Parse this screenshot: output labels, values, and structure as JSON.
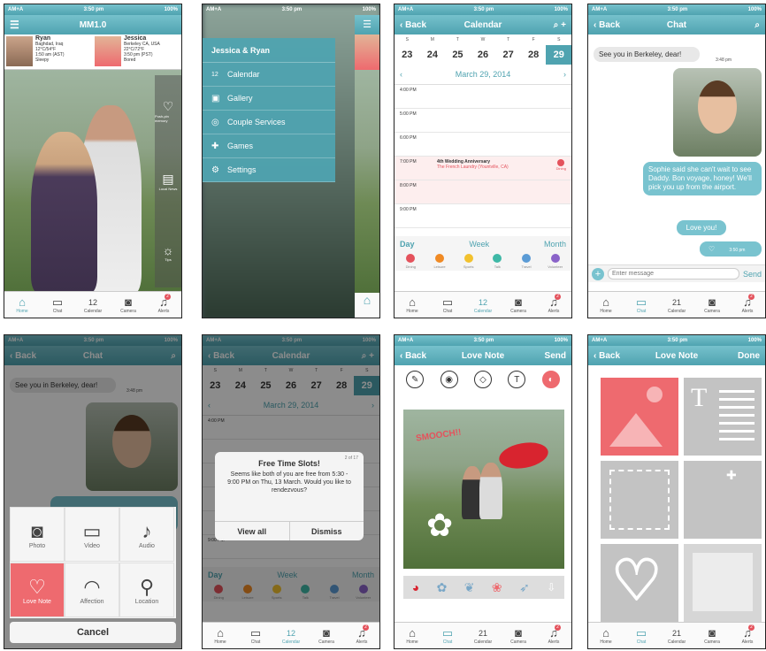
{
  "status": {
    "carrier": "AM+A",
    "time": "3:50 pm",
    "battery": "100%"
  },
  "colors": {
    "teal": "#4fa3b0",
    "red": "#ee6a6f"
  },
  "tabs": [
    {
      "label": "Home",
      "icon": "home-icon"
    },
    {
      "label": "Chat",
      "icon": "chat-icon"
    },
    {
      "label": "Calendar",
      "icon": "calendar-icon",
      "glyph": "12"
    },
    {
      "label": "Camera",
      "icon": "camera-icon"
    },
    {
      "label": "Alerts",
      "icon": "bell-icon",
      "badge": "2"
    }
  ],
  "tabs_cal21": "21",
  "home": {
    "title": "MM1.0",
    "person1": {
      "name": "Ryan",
      "location": "Baghdad, Iraq",
      "weather": "12°C/54°F",
      "time": "1:50 am (AST)",
      "status": "Sleepy"
    },
    "person2": {
      "name": "Jessica",
      "location": "Berkeley CA, USA",
      "weather": "22°C/72°F",
      "time": "3:50 pm (PST)",
      "status": "Bored"
    },
    "side": [
      {
        "label": "Push-pin memory",
        "icon": "heart-icon"
      },
      {
        "label": "Local News",
        "icon": "news-icon"
      },
      {
        "label": "Tips",
        "icon": "bulb-icon"
      }
    ]
  },
  "menu": {
    "title": "Jessica & Ryan",
    "items": [
      {
        "label": "Calendar",
        "icon": "calendar-icon",
        "glyph": "12"
      },
      {
        "label": "Gallery",
        "icon": "gallery-icon",
        "glyph": "▣"
      },
      {
        "label": "Couple Services",
        "icon": "services-icon",
        "glyph": "◎"
      },
      {
        "label": "Games",
        "icon": "gamepad-icon",
        "glyph": "✚"
      },
      {
        "label": "Settings",
        "icon": "gear-icon",
        "glyph": "⚙"
      }
    ]
  },
  "calendar": {
    "back": "Back",
    "title": "Calendar",
    "weekdays": [
      "S",
      "M",
      "T",
      "W",
      "T",
      "F",
      "S"
    ],
    "days": [
      "23",
      "24",
      "25",
      "26",
      "27",
      "28",
      "29"
    ],
    "date": "March 29, 2014",
    "hours": [
      "4:00 PM",
      "5:00 PM",
      "6:00 PM",
      "7:00 PM",
      "8:00 PM",
      "9:00 PM"
    ],
    "event": {
      "title": "4th Wedding Anniversary",
      "place": "The French Laundry (Yountville, CA)",
      "category": "Dining"
    },
    "modes": [
      "Day",
      "Week",
      "Month"
    ],
    "categories": [
      {
        "label": "Dining",
        "color": "#e4525c"
      },
      {
        "label": "Leisure",
        "color": "#f08a24"
      },
      {
        "label": "Sports",
        "color": "#f2c12e"
      },
      {
        "label": "Talk",
        "color": "#3fb8a6"
      },
      {
        "label": "Travel",
        "color": "#5b9bd5"
      },
      {
        "label": "Volunteer",
        "color": "#8a63c9"
      }
    ]
  },
  "chat": {
    "back": "Back",
    "title": "Chat",
    "msg1": "See you in Berkeley, dear!",
    "time1": "3:48 pm",
    "msg2": "Sophie said she can't wait to see Daddy. Bon voyage, honey! We'll pick you up from the airport.",
    "msg3": "Love you!",
    "msg4": "♡",
    "time4": "3:50 pm",
    "placeholder": "Enter message",
    "send": "Send"
  },
  "attach": {
    "items": [
      {
        "label": "Photo",
        "icon": "camera-icon",
        "glyph": "◙"
      },
      {
        "label": "Video",
        "icon": "video-icon",
        "glyph": "▭"
      },
      {
        "label": "Audio",
        "icon": "microphone-icon",
        "glyph": "♪"
      },
      {
        "label": "Love Note",
        "icon": "love-note-icon",
        "glyph": "♡"
      },
      {
        "label": "Affection",
        "icon": "lips-icon",
        "glyph": "◠"
      },
      {
        "label": "Location",
        "icon": "location-pin-icon",
        "glyph": "⚲"
      }
    ],
    "cancel": "Cancel"
  },
  "alert": {
    "title": "Free Time Slots!",
    "counter": "2 of 17",
    "body": "Seems like both of you are free from 5:30 - 9:00 PM on Thu, 13 March. Would you like to rendezvous?",
    "view": "View all",
    "dismiss": "Dismiss"
  },
  "lovenote": {
    "back": "Back",
    "title": "Love Note",
    "send": "Send",
    "done": "Done",
    "smooch": "SMOOCH!!"
  }
}
